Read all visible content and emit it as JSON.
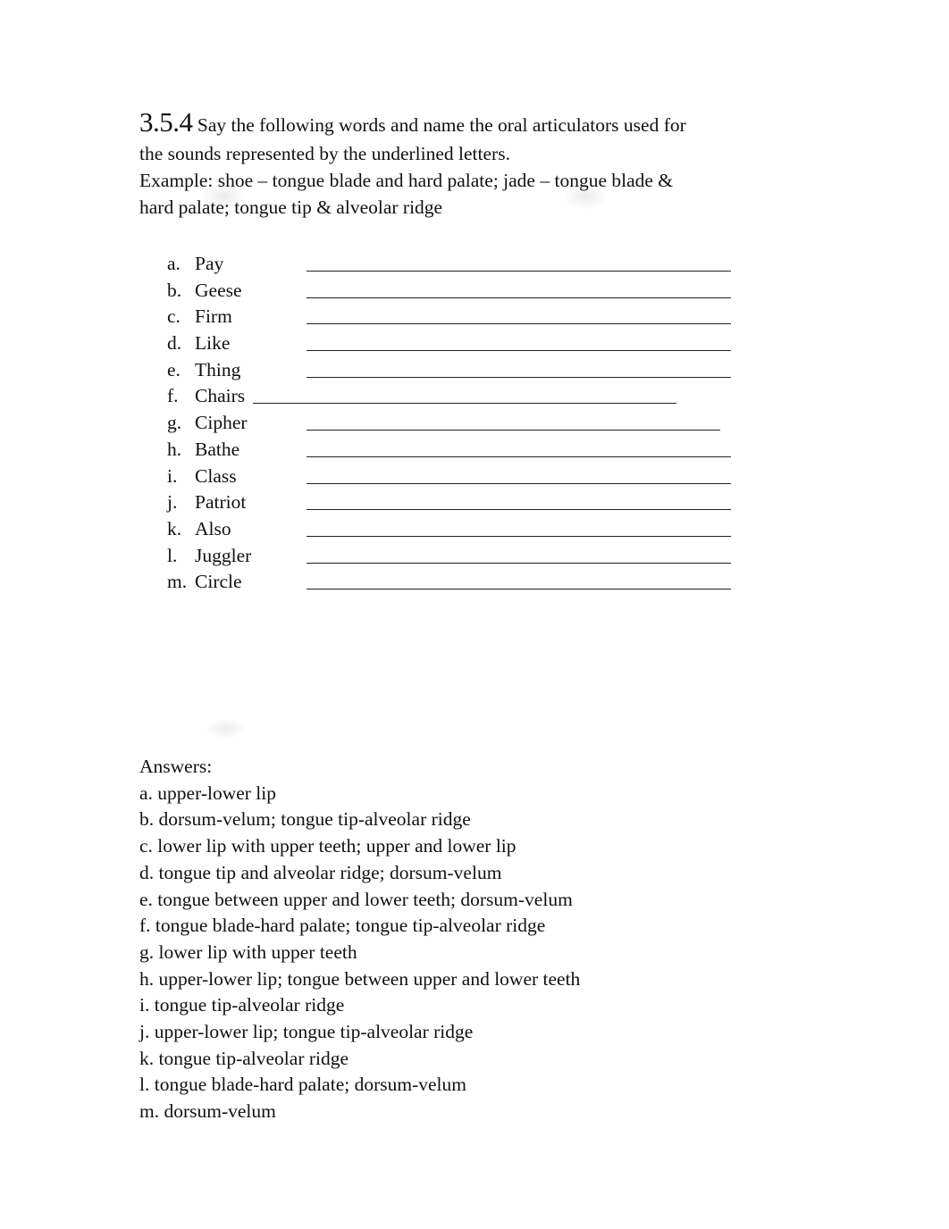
{
  "exercise": {
    "number": "3.5.4",
    "instruction_line1": "Say the following words and name the oral articulators used for",
    "instruction_line2": "the sounds represented by the underlined letters.",
    "example_line1": "Example: shoe – tongue blade and hard palate; jade – tongue blade &",
    "example_line2": "hard palate; tongue tip & alveolar ridge"
  },
  "items": [
    {
      "letter": "a.",
      "word": "Pay"
    },
    {
      "letter": "b.",
      "word": "Geese"
    },
    {
      "letter": "c.",
      "word": "Firm"
    },
    {
      "letter": "d.",
      "word": "Like"
    },
    {
      "letter": "e.",
      "word": "Thing"
    },
    {
      "letter": "f.",
      "word": "Chairs"
    },
    {
      "letter": "g.",
      "word": "Cipher"
    },
    {
      "letter": "h.",
      "word": "Bathe"
    },
    {
      "letter": "i.",
      "word": "Class"
    },
    {
      "letter": "j.",
      "word": "Patriot"
    },
    {
      "letter": "k.",
      "word": "Also"
    },
    {
      "letter": "l.",
      "word": "Juggler"
    },
    {
      "letter": "m.",
      "word": "Circle"
    }
  ],
  "answers": {
    "title": "Answers:",
    "lines": [
      "a. upper-lower lip",
      "b. dorsum-velum; tongue tip-alveolar ridge",
      "c. lower lip with upper teeth; upper and lower lip",
      "d. tongue tip and alveolar ridge; dorsum-velum",
      "e. tongue between upper and lower teeth; dorsum-velum",
      "f. tongue blade-hard palate; tongue tip-alveolar ridge",
      "g. lower lip with upper teeth",
      "h. upper-lower lip; tongue between upper and lower teeth",
      "i. tongue tip-alveolar ridge",
      "j. upper-lower lip; tongue tip-alveolar ridge",
      "k. tongue tip-alveolar ridge",
      "l. tongue blade-hard palate; dorsum-velum",
      "m. dorsum-velum"
    ]
  }
}
